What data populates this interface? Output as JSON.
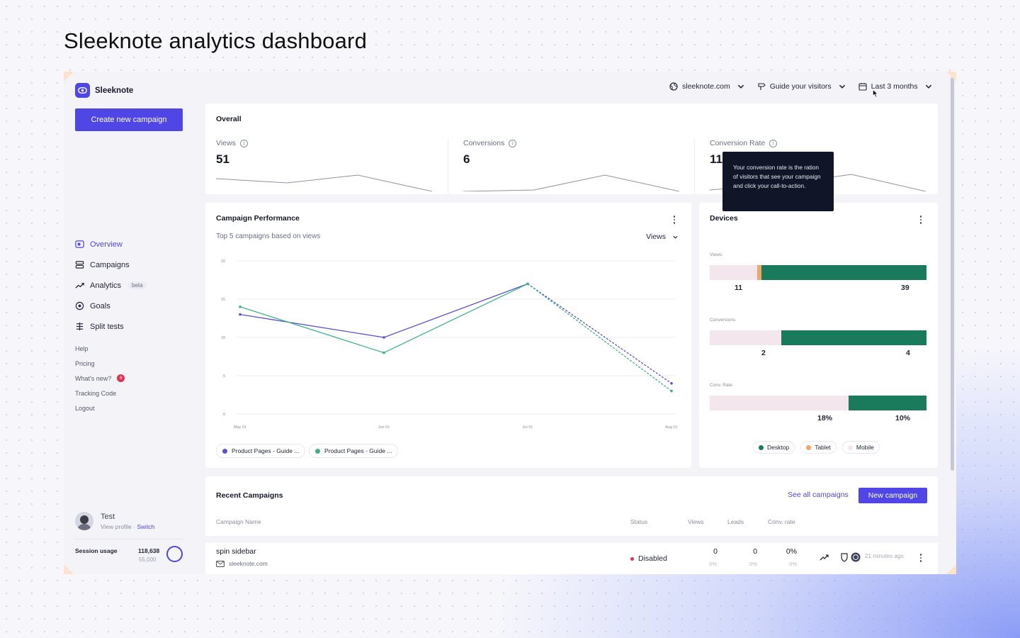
{
  "page": {
    "title": "Sleeknote analytics dashboard"
  },
  "app": {
    "name": "Sleeknote",
    "create_button": "Create new campaign"
  },
  "topbar": {
    "site": "sleeknote.com",
    "goal": "Guide your visitors",
    "period": "Last 3 months"
  },
  "sidebar": {
    "nav": [
      {
        "label": "Overview",
        "icon": "overview-icon",
        "active": true
      },
      {
        "label": "Campaigns",
        "icon": "campaigns-icon"
      },
      {
        "label": "Analytics",
        "icon": "analytics-icon",
        "badge": "beta"
      },
      {
        "label": "Goals",
        "icon": "goals-icon"
      },
      {
        "label": "Split tests",
        "icon": "split-tests-icon"
      }
    ],
    "links": [
      "Help",
      "Pricing",
      "What's new?",
      "Tracking Code",
      "Logout"
    ],
    "whats_new_count": "6",
    "profile": {
      "name": "Test",
      "view_profile": "View profile",
      "switch": "Switch"
    },
    "session": {
      "label": "Session usage",
      "used": "118,638",
      "limit": "55,000"
    }
  },
  "overall": {
    "title": "Overall",
    "metrics": [
      {
        "label": "Views",
        "value": "51"
      },
      {
        "label": "Conversions",
        "value": "6"
      },
      {
        "label": "Conversion Rate",
        "value": "11."
      }
    ],
    "tooltip": "Your conversion rate is the ration of visitors that see your campaign and click your call-to-action."
  },
  "performance": {
    "title": "Campaign Performance",
    "subtitle": "Top 5 campaigns based on views",
    "metric_select": "Views",
    "legend": [
      "Product Pages - Guide ...",
      "Product Pages - Guide ..."
    ]
  },
  "chart_data": {
    "type": "line",
    "x": [
      "May 01",
      "Jun 01",
      "Jul 01",
      "Aug 01"
    ],
    "y_ticks": [
      "20",
      "15",
      "10",
      "5",
      "0"
    ],
    "ylim": [
      0,
      20
    ],
    "series": [
      {
        "name": "Product Pages - Guide ...",
        "color": "#5b50d6",
        "points": [
          [
            0,
            13
          ],
          [
            1,
            10
          ],
          [
            2,
            17
          ],
          [
            3,
            4
          ]
        ]
      },
      {
        "name": "Product Pages - Guide ...",
        "color": "#3fb28a",
        "points": [
          [
            0,
            14
          ],
          [
            1,
            8
          ],
          [
            2,
            17
          ],
          [
            3,
            3
          ]
        ]
      }
    ],
    "dashed_last_segment": true,
    "grid": true
  },
  "devices": {
    "title": "Devices",
    "rows": [
      {
        "label": "Views",
        "left": "11",
        "right": "39",
        "tablet_share": 0.02,
        "desktop_share": 0.76
      },
      {
        "label": "Conversions",
        "left": "2",
        "right": "4",
        "tablet_share": 0,
        "desktop_share": 0.67
      },
      {
        "label": "Conv. Rate",
        "left": "18%",
        "right": "10%",
        "tablet_share": 0,
        "desktop_share": 0.36
      }
    ],
    "legend": [
      "Desktop",
      "Tablet",
      "Mobile"
    ],
    "colors": {
      "desktop": "#1a7a5c",
      "tablet": "#f0a868",
      "mobile": "#f3e6ec"
    }
  },
  "recent": {
    "title": "Recent Campaigns",
    "see_all": "See all campaigns",
    "new_campaign": "New campaign",
    "columns": [
      "Campaign Name",
      "Status",
      "Views",
      "Leads",
      "Conv. rate"
    ],
    "rows": [
      {
        "name": "spin sidebar",
        "site": "sleeknote.com",
        "status": "Disabled",
        "views": "0",
        "views_sub": "0%",
        "leads": "0",
        "leads_sub": "0%",
        "conv": "0%",
        "conv_sub": "0%",
        "ago": "21 minutes ago"
      }
    ]
  }
}
